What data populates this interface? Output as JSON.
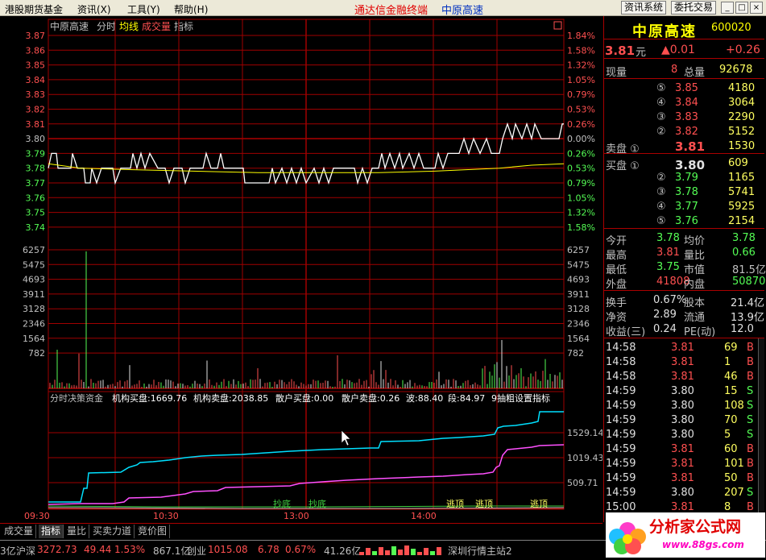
{
  "menubar": {
    "app": "港股期货基金",
    "menus": [
      "资讯(X)",
      "工具(Y)",
      "帮助(H)"
    ],
    "brand": "通达信金融终端",
    "stock_title": "中原高速",
    "buttons": [
      "资讯系统",
      "委托交易"
    ],
    "win": [
      "_",
      "□",
      "×"
    ]
  },
  "chart": {
    "header": {
      "name": "中原高速",
      "mode": "分时",
      "avg": "均线",
      "vol": "成交量",
      "ind": "指标"
    },
    "price_ticks": [
      "3.87",
      "3.86",
      "3.85",
      "3.84",
      "3.83",
      "3.82",
      "3.81",
      "3.80",
      "3.79",
      "3.78",
      "3.77",
      "3.76",
      "3.75",
      "3.74"
    ],
    "pct_ticks": [
      "1.84%",
      "1.58%",
      "1.32%",
      "1.05%",
      "0.79%",
      "0.53%",
      "0.26%",
      "0.00%",
      "0.26%",
      "0.53%",
      "0.79%",
      "1.05%",
      "1.32%",
      "1.58%"
    ],
    "vol_ticks": [
      "6257",
      "5475",
      "4693",
      "3911",
      "3128",
      "2346",
      "1564",
      "782"
    ],
    "ind_header": {
      "name": "分时决策资金",
      "inst_buy": "机构买盘:1669.76",
      "inst_sell": "机构卖盘:2038.85",
      "retail_buy": "散户买盘:0.00",
      "retail_sell": "散户卖盘:0.26",
      "wave": "波:88.40",
      "seg": "段:84.97",
      "right": "9抽粗设置指标"
    },
    "ind_ticks": [
      "1529.14",
      "1019.43",
      "509.71"
    ],
    "ind_labels": {
      "bottom1": "抄底",
      "bottom2": "抄底",
      "top1": "逃顶",
      "top2": "逃顶",
      "top3": "逃顶"
    },
    "time_ticks": [
      "09:30",
      "10:30",
      "13:00",
      "14:00"
    ],
    "colors": {
      "up": "#ff5050",
      "down": "#54fc54",
      "price": "#ffffff",
      "avg": "#ffff00",
      "grid": "#a00000",
      "cyan": "#00e0ff",
      "magenta": "#ff50ff"
    }
  },
  "quote": {
    "name": "中原高速",
    "code": "600020",
    "price": "3.81",
    "unit": "元",
    "change": "▲0.01",
    "change_pct": "+0.26",
    "now_label": "现量",
    "now_val": "8",
    "total_label": "总量",
    "total_val": "92678",
    "sells": [
      {
        "l": "⑤",
        "p": "3.85",
        "v": "4180"
      },
      {
        "l": "④",
        "p": "3.84",
        "v": "3064"
      },
      {
        "l": "③",
        "p": "3.83",
        "v": "2290"
      },
      {
        "l": "②",
        "p": "3.82",
        "v": "5152"
      },
      {
        "l": "卖盘 ①",
        "p": "3.81",
        "v": "1530"
      }
    ],
    "buys": [
      {
        "l": "买盘 ①",
        "p": "3.80",
        "v": "609"
      },
      {
        "l": "②",
        "p": "3.79",
        "v": "1165"
      },
      {
        "l": "③",
        "p": "3.78",
        "v": "5741"
      },
      {
        "l": "④",
        "p": "3.77",
        "v": "5925"
      },
      {
        "l": "⑤",
        "p": "3.76",
        "v": "2154"
      }
    ],
    "stats": [
      {
        "a": "今开",
        "av": "3.78",
        "ac": "#54fc54",
        "b": "均价",
        "bv": "3.78",
        "bc": "#54fc54"
      },
      {
        "a": "最高",
        "av": "3.81",
        "ac": "#ff5050",
        "b": "量比",
        "bv": "0.66",
        "bc": "#54fc54"
      },
      {
        "a": "最低",
        "av": "3.75",
        "ac": "#54fc54",
        "b": "市值",
        "bv": "81.5亿",
        "bc": "#c0c0c0"
      },
      {
        "a": "外盘",
        "av": "41808",
        "ac": "#ff5050",
        "b": "内盘",
        "bv": "50870",
        "bc": "#54fc54"
      }
    ],
    "stats2": [
      {
        "a": "换手",
        "av": "0.67%",
        "b": "股本",
        "bv": "21.4亿"
      },
      {
        "a": "净资",
        "av": "2.89",
        "b": "流通",
        "bv": "13.9亿"
      },
      {
        "a": "收益(三)",
        "av": "0.24",
        "b": "PE(动)",
        "bv": "12.0"
      }
    ],
    "ticks": [
      {
        "t": "14:58",
        "p": "3.81",
        "v": "69",
        "s": "B"
      },
      {
        "t": "14:58",
        "p": "3.81",
        "v": "1",
        "s": "B"
      },
      {
        "t": "14:58",
        "p": "3.81",
        "v": "46",
        "s": "B"
      },
      {
        "t": "14:59",
        "p": "3.80",
        "v": "15",
        "s": "S"
      },
      {
        "t": "14:59",
        "p": "3.80",
        "v": "108",
        "s": "S"
      },
      {
        "t": "14:59",
        "p": "3.80",
        "v": "70",
        "s": "S"
      },
      {
        "t": "14:59",
        "p": "3.80",
        "v": "5",
        "s": "S"
      },
      {
        "t": "14:59",
        "p": "3.81",
        "v": "60",
        "s": "B"
      },
      {
        "t": "14:59",
        "p": "3.81",
        "v": "101",
        "s": "B"
      },
      {
        "t": "14:59",
        "p": "3.81",
        "v": "50",
        "s": "B"
      },
      {
        "t": "14:59",
        "p": "3.80",
        "v": "207",
        "s": "S"
      },
      {
        "t": "15:00",
        "p": "3.81",
        "v": "8",
        "s": "B"
      }
    ]
  },
  "tabs": [
    "成交量",
    "指标",
    "量比",
    "买卖力道",
    "竞价图"
  ],
  "status": {
    "s1": "3亿",
    "s2": "沪深",
    "s3": "3272.73",
    "s4": "49.44",
    "s5": "1.53%",
    "s6": "867.1亿",
    "s7": "创业",
    "s8": "1015.08",
    "s9": "6.78",
    "s10": "0.67%",
    "s11": "41.26亿",
    "s12": "深圳行情主站2"
  },
  "logo": {
    "text": "分析家公式网",
    "url": "www.88gs.com"
  }
}
